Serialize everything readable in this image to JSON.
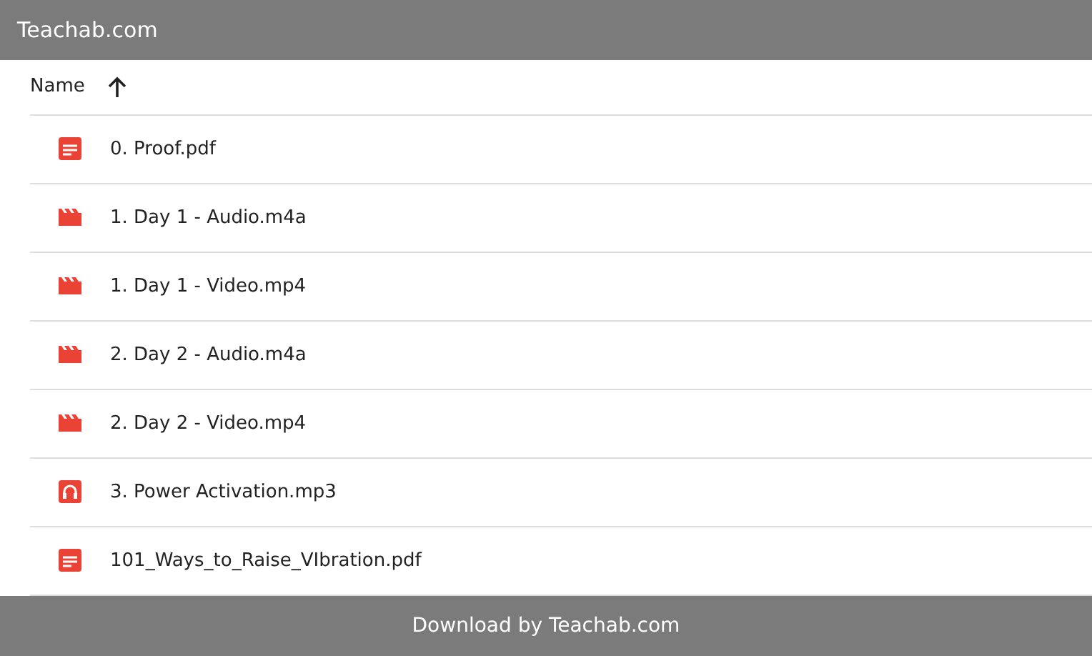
{
  "header": {
    "title": "Teachab.com"
  },
  "table": {
    "columns": [
      {
        "label": "Name",
        "sort_ascending": true
      }
    ],
    "rows": [
      {
        "name": "0. Proof.pdf",
        "kind": "pdf"
      },
      {
        "name": "1. Day 1 - Audio.m4a",
        "kind": "video"
      },
      {
        "name": "1. Day 1 - Video.mp4",
        "kind": "video"
      },
      {
        "name": "2. Day 2 - Audio.m4a",
        "kind": "video"
      },
      {
        "name": "2. Day 2 - Video.mp4",
        "kind": "video"
      },
      {
        "name": "3. Power Activation.mp3",
        "kind": "audio"
      },
      {
        "name": "101_Ways_to_Raise_VIbration.pdf",
        "kind": "pdf"
      }
    ]
  },
  "footer": {
    "text": "Download by Teachab.com"
  }
}
